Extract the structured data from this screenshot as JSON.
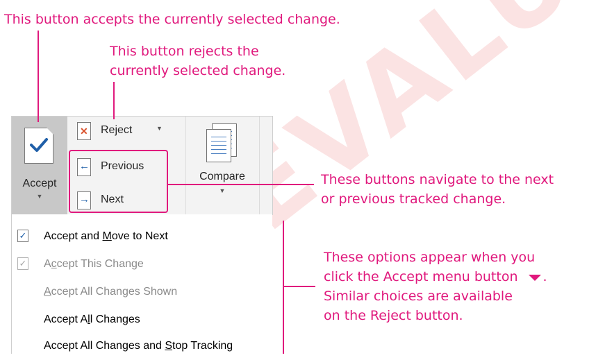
{
  "watermark": "EVALUATION",
  "callouts": {
    "accept": "This button accepts the currently selected change.",
    "reject_line1": "This button rejects the",
    "reject_line2": "currently selected change.",
    "nav_line1": "These buttons navigate to the next",
    "nav_line2": "or previous tracked change.",
    "menu_line1": "These options appear when you",
    "menu_line2_prefix": "click the Accept menu button",
    "menu_line2_suffix": ".",
    "menu_line3": "Similar choices are available",
    "menu_line4": "on the Reject button."
  },
  "ribbon": {
    "accept_label": "Accept",
    "reject_label": "Reject",
    "previous_label": "Previous",
    "next_label": "Next",
    "compare_label": "Compare"
  },
  "accept_menu": {
    "items": [
      {
        "label": "Accept and Move to Next",
        "mnemonic": "M",
        "has_icon": true,
        "enabled": true
      },
      {
        "label": "Accept This Change",
        "mnemonic": "c",
        "has_icon": true,
        "enabled": false
      },
      {
        "label": "Accept All Changes Shown",
        "mnemonic": "A",
        "has_icon": false,
        "enabled": false
      },
      {
        "label": "Accept All Changes",
        "mnemonic": "l",
        "has_icon": false,
        "enabled": true
      },
      {
        "label": "Accept All Changes and Stop Tracking",
        "mnemonic": "S",
        "has_icon": false,
        "enabled": true
      }
    ]
  },
  "colors": {
    "callout": "#e0197d",
    "ribbon_bg": "#f3f3f3",
    "accept_pressed_bg": "#c8c8c8",
    "check": "#1f5fa8"
  }
}
